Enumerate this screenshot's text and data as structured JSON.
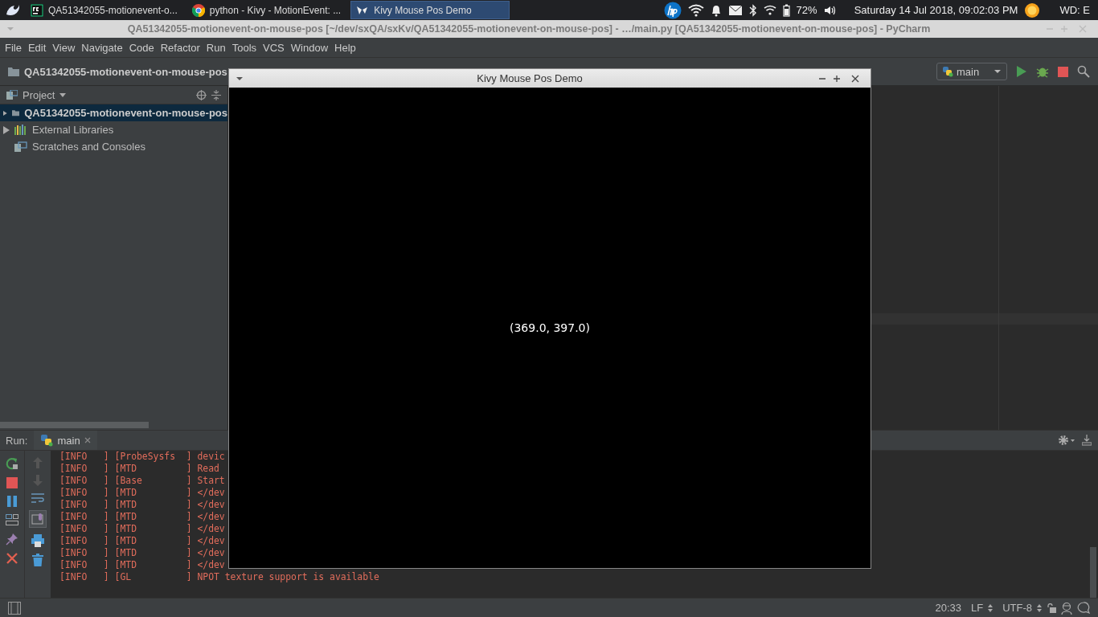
{
  "taskbar": {
    "tasks": [
      {
        "label": "QA51342055-motionevent-o...",
        "selected": false,
        "kind": "pycharm"
      },
      {
        "label": "python - Kivy - MotionEvent: ...",
        "selected": false,
        "kind": "chrome"
      },
      {
        "label": "Kivy Mouse Pos Demo",
        "selected": true,
        "kind": "kivy"
      }
    ],
    "battery": "72%",
    "clock": "Saturday 14 Jul 2018, 09:02:03 PM",
    "workspace": "WD: E"
  },
  "ide": {
    "title": "QA51342055-motionevent-on-mouse-pos [~/dev/sxQA/sxKv/QA51342055-motionevent-on-mouse-pos] - …/main.py [QA51342055-motionevent-on-mouse-pos] - PyCharm",
    "menu": [
      "File",
      "Edit",
      "View",
      "Navigate",
      "Code",
      "Refactor",
      "Run",
      "Tools",
      "VCS",
      "Window",
      "Help"
    ],
    "breadcrumb": "QA51342055-motionevent-on-mouse-pos",
    "run_config": "main",
    "project": {
      "header": "Project",
      "items": [
        {
          "label": "QA51342055-motionevent-on-mouse-pos",
          "kind": "folder",
          "selected": true
        },
        {
          "label": "External Libraries",
          "kind": "library",
          "selected": false
        },
        {
          "label": "Scratches and Consoles",
          "kind": "scratches",
          "selected": false
        }
      ]
    },
    "run": {
      "label": "Run:",
      "tab": "main",
      "lines": [
        "[INFO   ] [ProbeSysfs  ] devic",
        "[INFO   ] [MTD         ] Read",
        "[INFO   ] [Base        ] Start",
        "[INFO   ] [MTD         ] </dev",
        "[INFO   ] [MTD         ] </dev",
        "[INFO   ] [MTD         ] </dev",
        "[INFO   ] [MTD         ] </dev",
        "[INFO   ] [MTD         ] </dev",
        "[INFO   ] [MTD         ] </dev",
        "[INFO   ] [MTD         ] </dev",
        "[INFO   ] [GL          ] NPOT texture support is available"
      ]
    },
    "status": {
      "position": "20:33",
      "line_sep": "LF",
      "encoding": "UTF-8"
    }
  },
  "kivy_window": {
    "title": "Kivy Mouse Pos Demo",
    "label": "(369.0, 397.0)"
  }
}
